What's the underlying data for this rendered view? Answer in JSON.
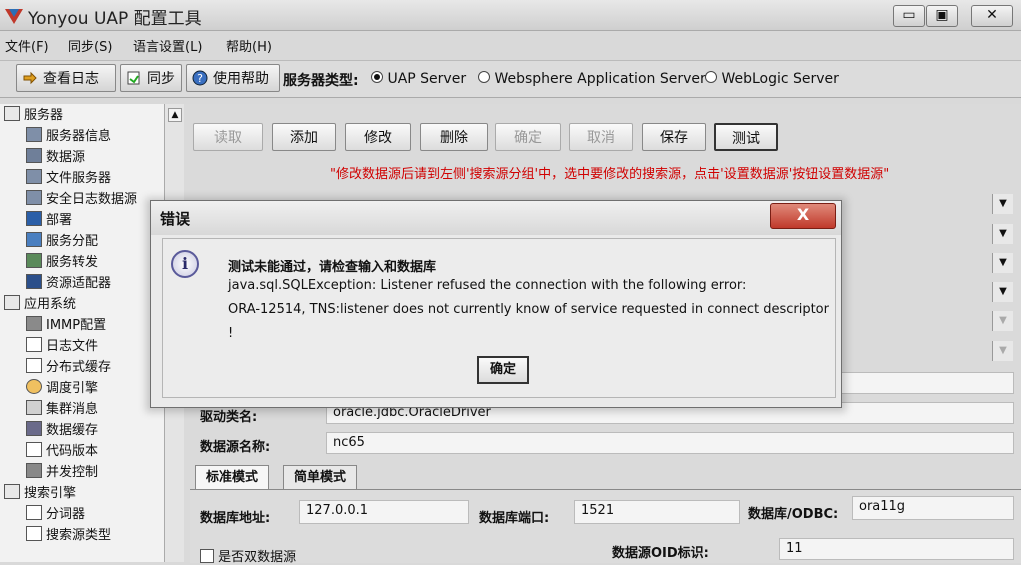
{
  "window": {
    "title": "Yonyou UAP 配置工具",
    "btn_minimize": "▭",
    "btn_restore": "▣",
    "btn_close": "✕"
  },
  "menu": [
    "文件(F)",
    "同步(S)",
    "语言设置(L)",
    "帮助(H)"
  ],
  "toolbar": {
    "view_log": "查看日志",
    "sync": "同步",
    "help": "使用帮助",
    "server_type_label": "服务器类型:",
    "server_options": [
      "UAP Server",
      "Websphere Application Server",
      "WebLogic Server"
    ],
    "selected_server": "UAP Server"
  },
  "tree": [
    {
      "label": "服务器",
      "level": 0,
      "icon": "folder-icon"
    },
    {
      "label": "服务器信息",
      "level": 1,
      "icon": "monitor-icon"
    },
    {
      "label": "数据源",
      "level": 1,
      "icon": "datasource-icon"
    },
    {
      "label": "文件服务器",
      "level": 1,
      "icon": "monitor-icon"
    },
    {
      "label": "安全日志数据源",
      "level": 1,
      "icon": "monitor-icon"
    },
    {
      "label": "部署",
      "level": 1,
      "icon": "deploy-icon"
    },
    {
      "label": "服务分配",
      "level": 1,
      "icon": "service-icon"
    },
    {
      "label": "服务转发",
      "level": 1,
      "icon": "forward-icon"
    },
    {
      "label": "资源适配器",
      "level": 1,
      "icon": "adapter-icon"
    },
    {
      "label": "应用系统",
      "level": 0,
      "icon": "folder-icon"
    },
    {
      "label": "IMMP配置",
      "level": 1,
      "icon": "config-icon"
    },
    {
      "label": "日志文件",
      "level": 1,
      "icon": "file-icon"
    },
    {
      "label": "分布式缓存",
      "level": 1,
      "icon": "file-icon"
    },
    {
      "label": "调度引擎",
      "level": 1,
      "icon": "clock-icon"
    },
    {
      "label": "集群消息",
      "level": 1,
      "icon": "mail-icon"
    },
    {
      "label": "数据缓存",
      "level": 1,
      "icon": "cache-icon"
    },
    {
      "label": "代码版本",
      "level": 1,
      "icon": "file-icon"
    },
    {
      "label": "并发控制",
      "level": 1,
      "icon": "list-icon"
    },
    {
      "label": "搜索引擎",
      "level": 0,
      "icon": "folder-icon"
    },
    {
      "label": "分词器",
      "level": 1,
      "icon": "file-icon"
    },
    {
      "label": "搜索源类型",
      "level": 1,
      "icon": "file-icon"
    }
  ],
  "actions": [
    "读取",
    "添加",
    "修改",
    "删除",
    "确定",
    "取消",
    "保存",
    "测试"
  ],
  "hint": "\"修改数据源后请到左侧'搜索源分组'中，选中要修改的搜索源，点击'设置数据源'按钮设置数据源\"",
  "form": {
    "driver_label": "驱动类名:",
    "driver_value": "oracle.jdbc.OracleDriver",
    "ds_name_label": "数据源名称:",
    "ds_name_value": "nc65",
    "tabs": [
      "标准模式",
      "简单模式"
    ],
    "db_addr_label": "数据库地址:",
    "db_addr_value": "127.0.0.1",
    "db_port_label": "数据库端口:",
    "db_port_value": "1521",
    "db_odbc_label": "数据库/ODBC:",
    "db_odbc_value": "ora11g",
    "dual_label": "是否双数据源",
    "oid_label": "数据源OID标识:",
    "oid_value": "11"
  },
  "dialog": {
    "title": "错误",
    "close": "X",
    "line1": "测试未能通过，请检查输入和数据库",
    "line2": "java.sql.SQLException: Listener refused the connection with the following error:",
    "line3": "ORA-12514, TNS:listener does not currently know of service requested in connect descriptor",
    "line4": "!",
    "ok": "确定"
  }
}
